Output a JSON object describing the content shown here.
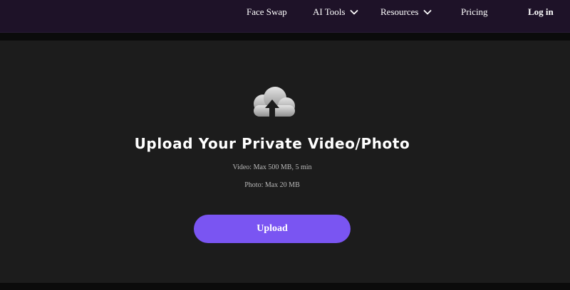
{
  "nav": {
    "items": [
      {
        "label": "Face Swap",
        "has_dropdown": false
      },
      {
        "label": "AI Tools",
        "has_dropdown": true
      },
      {
        "label": "Resources",
        "has_dropdown": true
      },
      {
        "label": "Pricing",
        "has_dropdown": false
      }
    ],
    "login_label": "Log in"
  },
  "upload_panel": {
    "icon": "cloud-upload-icon",
    "title": "Upload Your Private Video/Photo",
    "video_limit": "Video: Max 500 MB, 5 min",
    "photo_limit": "Photo: Max 20 MB",
    "button_label": "Upload"
  },
  "colors": {
    "nav_background": "#1e1228",
    "panel_background": "#1c1c1c",
    "page_background": "#0b0b0b",
    "button_accent": "#7a55f2"
  }
}
